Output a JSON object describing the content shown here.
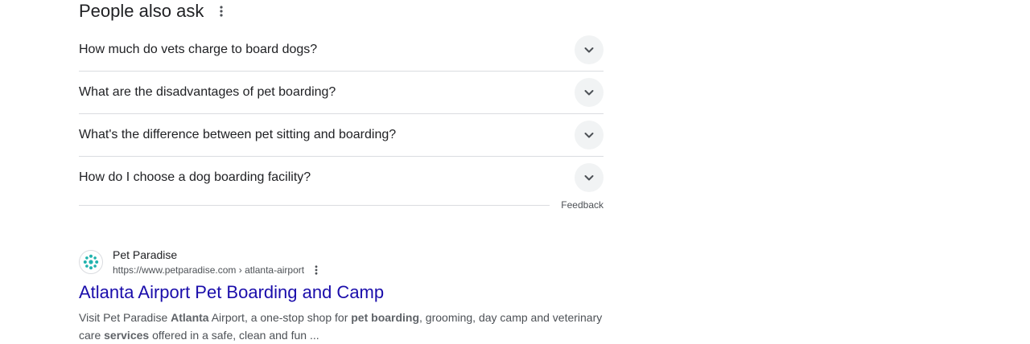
{
  "paa": {
    "title": "People also ask",
    "questions": [
      "How much do vets charge to board dogs?",
      "What are the disadvantages of pet boarding?",
      "What's the difference between pet sitting and boarding?",
      "How do I choose a dog boarding facility?"
    ],
    "feedback": "Feedback"
  },
  "result": {
    "site_name": "Pet Paradise",
    "url": "https://www.petparadise.com › atlanta-airport",
    "title": "Atlanta Airport Pet Boarding and Camp",
    "snippet": {
      "s1": "Visit Pet Paradise ",
      "b1": "Atlanta",
      "s2": " Airport, a one-stop shop for ",
      "b2": "pet boarding",
      "s3": ", grooming, day camp and veterinary care ",
      "b3": "services",
      "s4": " offered in a safe, clean and fun ..."
    },
    "brand_color": "#21b3ae"
  },
  "colors": {
    "link": "#1a0dab",
    "text": "#202124",
    "muted": "#4d5156",
    "divider": "#dadce0",
    "chevron_bg": "#f1f3f4"
  }
}
